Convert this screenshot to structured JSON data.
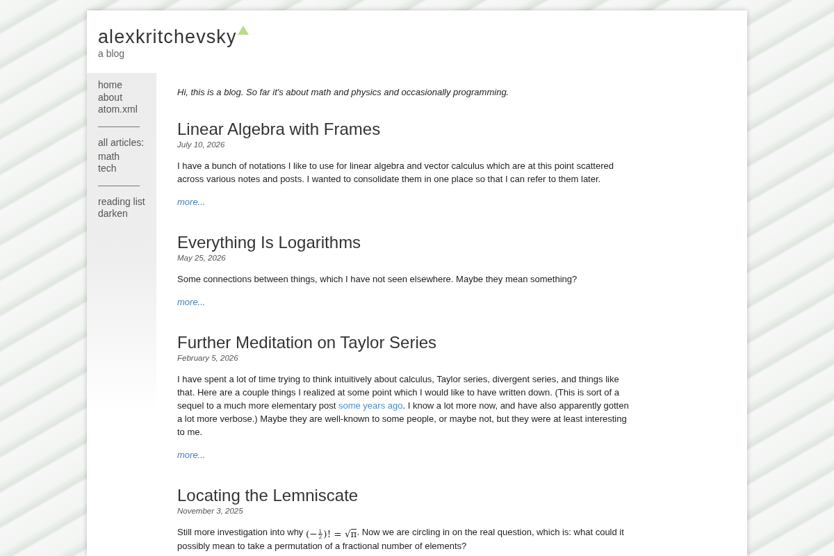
{
  "site": {
    "title": "alexkritchevsky",
    "subtitle": "a blog"
  },
  "sidebar": {
    "groups": [
      {
        "items": [
          {
            "label": "home"
          },
          {
            "label": "about"
          },
          {
            "label": "atom.xml"
          }
        ]
      },
      {
        "heading": "all articles:",
        "items": [
          {
            "label": "math"
          },
          {
            "label": "tech"
          }
        ]
      },
      {
        "items": [
          {
            "label": "reading list"
          },
          {
            "label": "darken"
          }
        ]
      }
    ]
  },
  "intro": "Hi, this is a blog. So far it's about math and physics and occasionally programming.",
  "posts": [
    {
      "title": "Linear Algebra with Frames",
      "date": "July 10, 2026",
      "body": [
        {
          "kind": "text",
          "text": "I have a bunch of notations I like to use for linear algebra and vector calculus which are at this point scattered across various notes and posts. I wanted to consolidate them in one place so that I can refer to them later."
        }
      ],
      "more": "more..."
    },
    {
      "title": "Everything Is Logarithms",
      "date": "May 25, 2026",
      "body": [
        {
          "kind": "text",
          "text": "Some connections between things, which I have not seen elsewhere. Maybe they mean something?"
        }
      ],
      "more": "more..."
    },
    {
      "title": "Further Meditation on Taylor Series",
      "date": "February 5, 2026",
      "body": [
        {
          "kind": "text",
          "text": "I have spent a lot of time trying to think intuitively about calculus, Taylor series, divergent series, and things like that. Here are a couple things I realized at some point which I would like to have written down. (This is sort of a sequel to a much more elementary post "
        },
        {
          "kind": "link",
          "text": "some years ago"
        },
        {
          "kind": "text",
          "text": ". I know a lot more now, and have also apparently gotten a lot more verbose.) Maybe they are well-known to some people, or maybe not, but they were at least interesting to me."
        }
      ],
      "more": "more..."
    },
    {
      "title": "Locating the Lemniscate",
      "date": "November 3, 2025",
      "body": [
        {
          "kind": "text",
          "text": "Still more investigation into why "
        },
        {
          "kind": "math",
          "lead": "(−",
          "numerator": "1",
          "denominator": "2",
          "tail": ")! =",
          "radical": "√",
          "radicand": "π"
        },
        {
          "kind": "text",
          "text": ". Now we are circling in on the real question, which is: what could it possibly mean to take a permutation of a fractional number of elements?"
        }
      ]
    }
  ]
}
